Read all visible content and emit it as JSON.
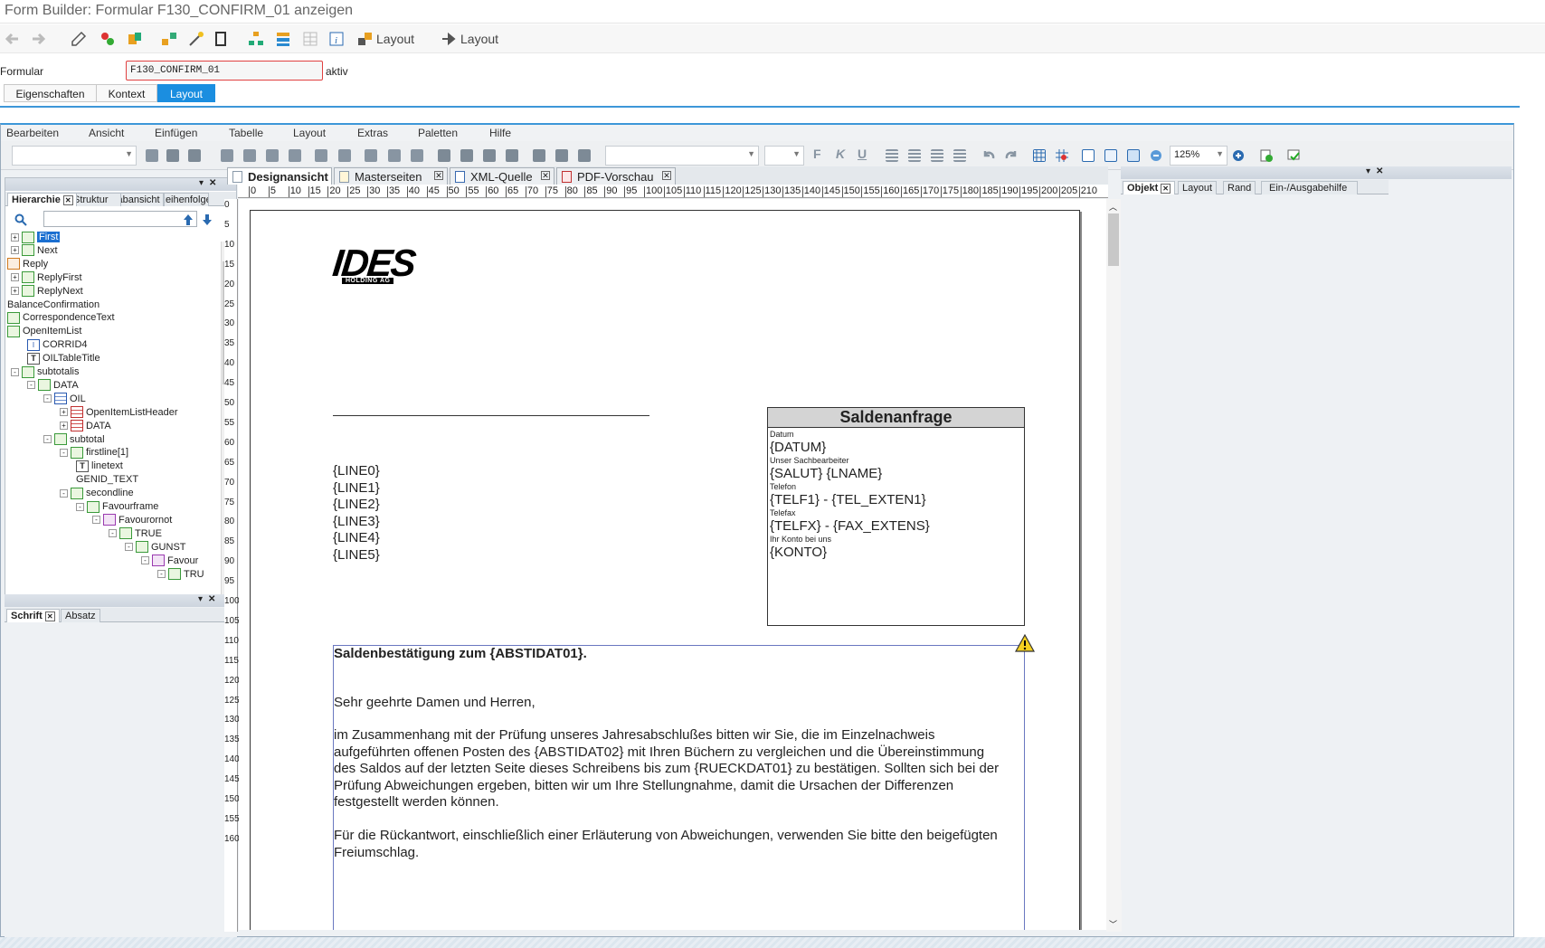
{
  "window": {
    "title": "Form Builder: Formular F130_CONFIRM_01 anzeigen"
  },
  "app_toolbar": {
    "layout_btn1": "Layout",
    "layout_btn2": "Layout"
  },
  "form": {
    "label": "Formular",
    "value": "F130_CONFIRM_01",
    "status": "aktiv"
  },
  "main_tabs": [
    {
      "label": "Eigenschaften"
    },
    {
      "label": "Kontext"
    },
    {
      "label": "Layout"
    }
  ],
  "menu": [
    "Bearbeiten",
    "Ansicht",
    "Einfügen",
    "Tabelle",
    "Layout",
    "Extras",
    "Paletten",
    "Hilfe"
  ],
  "zoom": "125%",
  "left_panel": {
    "tabs": [
      "Hierarchie",
      "Struktur",
      "Tabansicht",
      "Reihenfolge"
    ],
    "tree": [
      {
        "label": "First",
        "level": 0,
        "exp": "+",
        "icon": "page",
        "selected": true
      },
      {
        "label": "Next",
        "level": 0,
        "exp": "+",
        "icon": "page"
      },
      {
        "label": "Reply",
        "level": -1,
        "exp": "",
        "icon": "orange"
      },
      {
        "label": "ReplyFirst",
        "level": 0,
        "exp": "+",
        "icon": "page"
      },
      {
        "label": "ReplyNext",
        "level": 0,
        "exp": "+",
        "icon": "page"
      },
      {
        "label": "BalanceConfirmation",
        "level": -1,
        "exp": "",
        "icon": "none"
      },
      {
        "label": "CorrespondenceText",
        "level": -1,
        "exp": "",
        "icon": "page"
      },
      {
        "label": "OpenItemList",
        "level": -1,
        "exp": "",
        "icon": "page"
      },
      {
        "label": "CORRID4",
        "level": 1,
        "exp": "",
        "icon": "field"
      },
      {
        "label": "OILTableTitle",
        "level": 1,
        "exp": "",
        "icon": "text"
      },
      {
        "label": "subtotalis",
        "level": 0,
        "exp": "-",
        "icon": "page"
      },
      {
        "label": "DATA",
        "level": 1,
        "exp": "-",
        "icon": "page"
      },
      {
        "label": "OIL",
        "level": 2,
        "exp": "-",
        "icon": "table"
      },
      {
        "label": "OpenItemListHeader",
        "level": 3,
        "exp": "+",
        "icon": "red"
      },
      {
        "label": "DATA",
        "level": 3,
        "exp": "+",
        "icon": "red"
      },
      {
        "label": "subtotal",
        "level": 2,
        "exp": "-",
        "icon": "page"
      },
      {
        "label": "firstline[1]",
        "level": 3,
        "exp": "-",
        "icon": "page"
      },
      {
        "label": "linetext",
        "level": 4,
        "exp": "",
        "icon": "text"
      },
      {
        "label": "GENID_TEXT",
        "level": 4,
        "exp": "",
        "icon": "none"
      },
      {
        "label": "secondline",
        "level": 3,
        "exp": "-",
        "icon": "page"
      },
      {
        "label": "Favourframe",
        "level": 4,
        "exp": "-",
        "icon": "page"
      },
      {
        "label": "Favourornot",
        "level": 5,
        "exp": "-",
        "icon": "purple"
      },
      {
        "label": "TRUE",
        "level": 6,
        "exp": "-",
        "icon": "page"
      },
      {
        "label": "GUNST",
        "level": 7,
        "exp": "-",
        "icon": "page"
      },
      {
        "label": "Favour",
        "level": 8,
        "exp": "-",
        "icon": "purple"
      },
      {
        "label": "TRU",
        "level": 9,
        "exp": "-",
        "icon": "page"
      }
    ]
  },
  "font_panel": {
    "tabs": [
      "Schrift",
      "Absatz"
    ]
  },
  "doc_tabs": [
    {
      "label": "Designansicht"
    },
    {
      "label": "Masterseiten"
    },
    {
      "label": "XML-Quelle"
    },
    {
      "label": "PDF-Vorschau"
    }
  ],
  "right_panel": {
    "tabs": [
      "Objekt",
      "Layout",
      "Rand",
      "Ein-/Ausgabehilfe"
    ]
  },
  "ruler": {
    "h": [
      "0",
      "5",
      "10",
      "15",
      "20",
      "25",
      "30",
      "35",
      "40",
      "45",
      "50",
      "55",
      "60",
      "65",
      "70",
      "75",
      "80",
      "85",
      "90",
      "95",
      "100",
      "105",
      "110",
      "115",
      "120",
      "125",
      "130",
      "135",
      "140",
      "145",
      "150",
      "155",
      "160",
      "165",
      "170",
      "175",
      "180",
      "185",
      "190",
      "195",
      "200",
      "205",
      "210"
    ],
    "v": [
      "0",
      "5",
      "10",
      "15",
      "20",
      "25",
      "30",
      "35",
      "40",
      "45",
      "50",
      "55",
      "60",
      "65",
      "70",
      "75",
      "80",
      "85",
      "90",
      "95",
      "100",
      "105",
      "110",
      "115",
      "120",
      "125",
      "130",
      "135",
      "140",
      "145",
      "150",
      "155",
      "160"
    ]
  },
  "document": {
    "logo_top": "IDES",
    "logo_bottom": "HOLDING AG",
    "address_lines": [
      "{LINE0}",
      "{LINE1}",
      "{LINE2}",
      "{LINE3}",
      "{LINE4}",
      "{LINE5}"
    ],
    "box": {
      "title": "Saldenanfrage",
      "fields": [
        {
          "label": "Datum",
          "value": "{DATUM}"
        },
        {
          "label": "Unser Sachbearbeiter",
          "value": "{SALUT} {LNAME}"
        },
        {
          "label": "Telefon",
          "value": "{TELF1} - {TEL_EXTEN1}"
        },
        {
          "label": "Telefax",
          "value": "{TELFX} - {FAX_EXTENS}"
        },
        {
          "label": "Ihr Konto bei uns",
          "value": "{KONTO}"
        }
      ]
    },
    "heading": "Saldenbestätigung zum {ABSTIDAT01}.",
    "greeting": "Sehr geehrte Damen und Herren,",
    "para1_lines": [
      "im Zusammenhang mit der Prüfung unseres Jahresabschlußes bitten wir Sie, die im Einzelnachweis",
      "aufgeführten offenen Posten des {ABSTIDAT02} mit Ihren Büchern zu vergleichen und die Übereinstimmung",
      "des Saldos auf der letzten Seite dieses Schreibens bis zum {RUECKDAT01} zu bestätigen. Sollten sich bei der",
      "Prüfung Abweichungen ergeben, bitten wir um Ihre Stellungnahme, damit die Ursachen der Differenzen",
      "festgestellt werden können."
    ],
    "para2_lines": [
      "Für die Rückantwort, einschließlich einer Erläuterung von Abweichungen, verwenden Sie bitte den beigefügten",
      "Freiumschlag."
    ]
  }
}
